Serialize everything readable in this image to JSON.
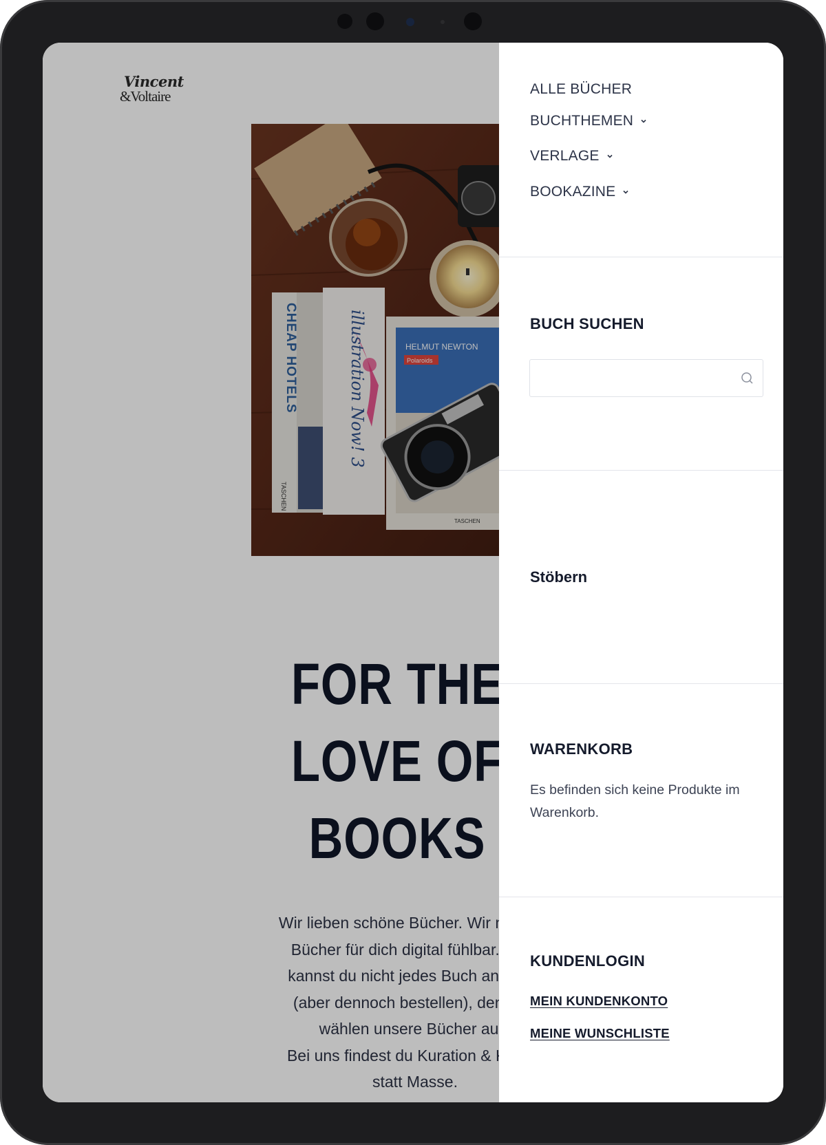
{
  "logo": {
    "line1": "Vincent",
    "line2": "&Voltaire"
  },
  "hero": {
    "headline": [
      "FOR THE",
      "LOVE OF",
      "BOOKS"
    ],
    "intro_lines": [
      "Wir lieben schöne Bücher. Wir machen",
      "Bücher für dich digital fühlbar. Zwar",
      "kannst du nicht jedes Buch ansehen",
      "(aber dennoch bestellen), denn wir",
      "wählen unsere Bücher aus.",
      "Bei uns findest du Kuration & Klasse",
      "statt Masse."
    ],
    "image_books": {
      "book1": "CHEAP HOTELS",
      "book1_publisher": "TASCHEN",
      "book2": "illustration Now! 3",
      "book4_title": "HELMUT NEWTON",
      "book4_sub": "Polaroids",
      "book4_publisher": "TASCHEN"
    }
  },
  "menu": {
    "nav": [
      {
        "label": "ALLE BÜCHER",
        "has_dropdown": false
      },
      {
        "label": "BUCHTHEMEN",
        "has_dropdown": true
      },
      {
        "label": "VERLAGE",
        "has_dropdown": true
      },
      {
        "label": "BOOKAZINE",
        "has_dropdown": true
      }
    ],
    "search": {
      "title": "BUCH SUCHEN",
      "value": "",
      "placeholder": ""
    },
    "browse": {
      "title": "Stöbern"
    },
    "cart": {
      "title": "WARENKORB",
      "empty_text": "Es befinden sich keine Produkte im Warenkorb."
    },
    "login": {
      "title": "KUNDENLOGIN",
      "account_link": "MEIN KUNDENKONTO",
      "wishlist_link": "MEINE WUNSCHLISTE"
    }
  },
  "colors": {
    "text_dark": "#151b2c",
    "text_body": "#2d3448",
    "overlay": "rgba(0,0,0,0.26)",
    "frame": "#1d1d1f"
  }
}
